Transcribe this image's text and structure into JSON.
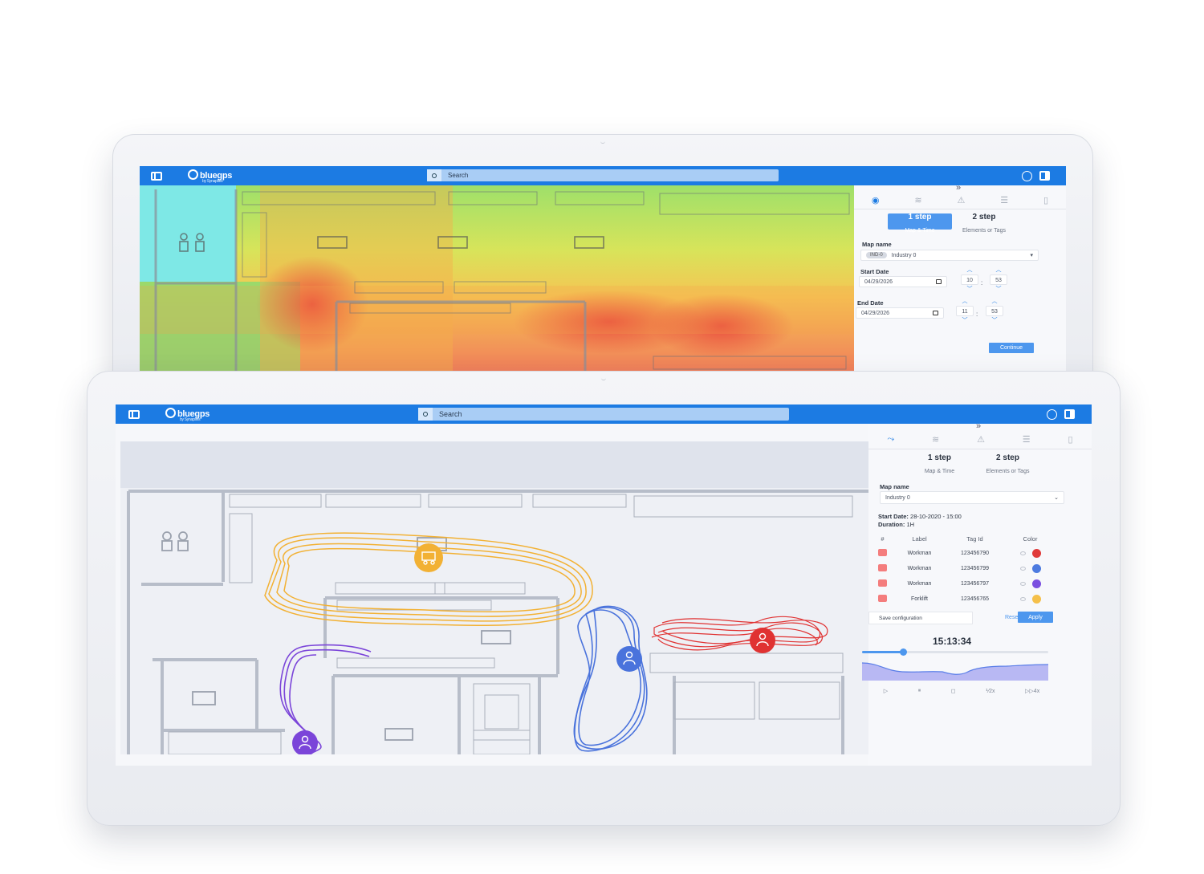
{
  "app": {
    "logo_text": "bluegps",
    "logo_sub": "by Synapses",
    "search_placeholder": "Search",
    "sidebar_chevron": "»"
  },
  "back_screen": {
    "steps": [
      {
        "label": "1 step",
        "sub": "Map & Time"
      },
      {
        "label": "2 step",
        "sub": "Elements or Tags"
      }
    ],
    "map_name_label": "Map name",
    "map_tag": "IND-0",
    "map_name_value": "Industry 0",
    "start_date_label": "Start Date",
    "start_date_value": "04/29/2026",
    "start_hour": "10",
    "start_minute": "53",
    "end_date_label": "End Date",
    "end_date_value": "04/29/2026",
    "end_hour": "11",
    "end_minute": "53",
    "continue_label": "Continue"
  },
  "front_screen": {
    "steps": [
      {
        "label": "1 step",
        "sub": "Map & Time"
      },
      {
        "label": "2 step",
        "sub": "Elements or Tags"
      }
    ],
    "map_name_label": "Map name",
    "map_name_value": "Industry 0",
    "start_date_prefix": "Start Date:",
    "start_date_value": "28-10-2020 - 15:00",
    "duration_prefix": "Duration:",
    "duration_value": "1H",
    "table_headers": [
      "#",
      "Label",
      "Tag Id",
      "Color"
    ],
    "tags": [
      {
        "label": "Workman",
        "tag_id": "123456790",
        "color": "#e03a3a"
      },
      {
        "label": "Workman",
        "tag_id": "123456799",
        "color": "#4d7be0"
      },
      {
        "label": "Workman",
        "tag_id": "123456797",
        "color": "#7a4fe0"
      },
      {
        "label": "Forklift",
        "tag_id": "123456765",
        "color": "#f5c04a"
      }
    ],
    "save_label": "Save configuration",
    "reset_label": "Reset",
    "apply_label": "Apply",
    "time": "15:13:34",
    "playback_progress": 0.22,
    "controls": [
      "▷",
      "⏸",
      "◻",
      "⅟2x",
      "▷▷4x"
    ]
  },
  "colors": {
    "brand": "#1c7be3",
    "accent": "#4d97ee",
    "track_yellow": "#f2b134",
    "track_purple": "#7b45d9",
    "track_blue": "#4a73dc",
    "track_red": "#e03232"
  }
}
